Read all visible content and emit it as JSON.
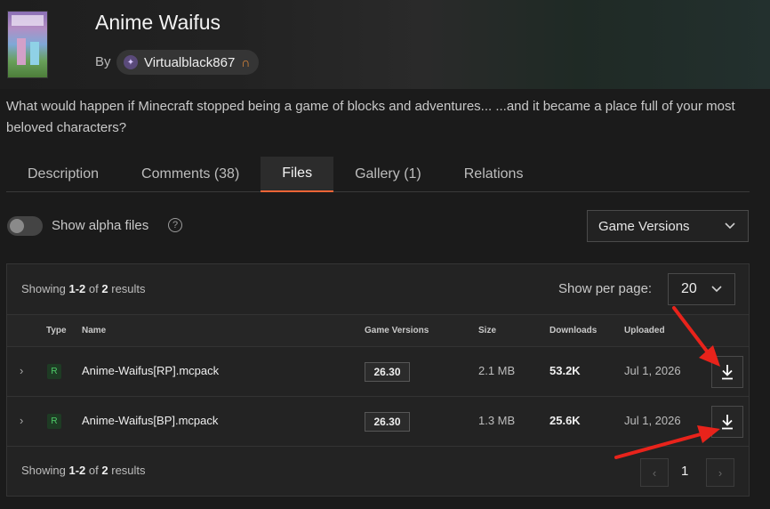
{
  "project": {
    "title": "Anime Waifus",
    "by_label": "By",
    "author": "Virtualblack867",
    "description": "What would happen if Minecraft stopped being a game of blocks and adventures... ...and it became a place full of your most beloved characters?"
  },
  "tabs": [
    {
      "label": "Description",
      "active": false
    },
    {
      "label": "Comments (38)",
      "active": false
    },
    {
      "label": "Files",
      "active": true
    },
    {
      "label": "Gallery (1)",
      "active": false
    },
    {
      "label": "Relations",
      "active": false
    }
  ],
  "filters": {
    "alpha_label": "Show alpha files",
    "alpha_enabled": false,
    "game_versions_label": "Game Versions"
  },
  "files_panel": {
    "showing_prefix": "Showing",
    "showing_range": "1-2",
    "showing_of": "of",
    "showing_total": "2",
    "showing_suffix": "results",
    "per_page_label": "Show per page:",
    "per_page_value": "20",
    "columns": {
      "type": "Type",
      "name": "Name",
      "game_versions": "Game Versions",
      "size": "Size",
      "downloads": "Downloads",
      "uploaded": "Uploaded"
    },
    "rows": [
      {
        "type": "R",
        "name": "Anime-Waifus[RP].mcpack",
        "game_version": "26.30",
        "size": "2.1 MB",
        "downloads": "53.2K",
        "uploaded": "Jul 1, 2026"
      },
      {
        "type": "R",
        "name": "Anime-Waifus[BP].mcpack",
        "game_version": "26.30",
        "size": "1.3 MB",
        "downloads": "25.6K",
        "uploaded": "Jul 1, 2026"
      }
    ],
    "current_page": "1"
  },
  "colors": {
    "accent": "#f16436",
    "release_green": "#4fcf6a",
    "annotation_red": "#e8231b"
  }
}
